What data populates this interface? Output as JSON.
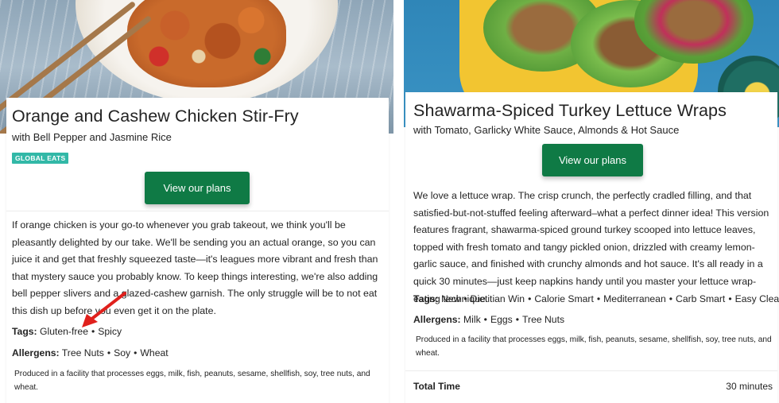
{
  "left_recipe": {
    "title": "Orange and Cashew Chicken Stir-Fry",
    "subtitle": "with Bell Pepper and Jasmine Rice",
    "badge": "GLOBAL EATS",
    "button_label": "View our plans",
    "description": "If orange chicken is your go-to whenever you grab takeout, we think you'll be pleasantly delighted by our take. We'll be sending you an actual orange, so you can juice it and get that freshly squeezed taste—it's leagues more vibrant and fresh than that mystery sauce you probably know. To keep things interesting, we're also adding bell pepper slivers and a glazed-cashew garnish. The only struggle will be to not eat this dish up before you even get it on the plate.",
    "tags_label": "Tags:",
    "tags": [
      "Gluten-free",
      "Spicy"
    ],
    "allergens_label": "Allergens:",
    "allergens": [
      "Tree Nuts",
      "Soy",
      "Wheat"
    ],
    "facility_note": "Produced in a facility that processes eggs, milk, fish, peanuts, sesame, shellfish, soy, tree nuts, and wheat.",
    "annotation_color": "#e0201c"
  },
  "right_recipe": {
    "title": "Shawarma-Spiced Turkey Lettuce Wraps",
    "subtitle": "with Tomato, Garlicky White Sauce, Almonds & Hot Sauce",
    "button_label": "View our plans",
    "description": "We love a lettuce wrap. The crisp crunch, the perfectly cradled filling, and that satisfied-but-not-stuffed feeling afterward–what a perfect dinner idea! This version features fragrant, shawarma-spiced ground turkey scooped into lettuce leaves, topped with fresh tomato and tangy pickled onion, drizzled with creamy lemon-garlic sauce, and finished with crunchy almonds and hot sauce. It's all ready in a quick 30 minutes—just keep napkins handy until you master your lettuce wrap-eating technique.",
    "tags_label": "Tags:",
    "tags": [
      "New",
      "Dietitian Win",
      "Calorie Smart",
      "Mediterranean",
      "Carb Smart",
      "Easy Cleanup"
    ],
    "allergens_label": "Allergens:",
    "allergens": [
      "Milk",
      "Eggs",
      "Tree Nuts"
    ],
    "facility_note": "Produced in a facility that processes eggs, milk, fish, peanuts, sesame, shellfish, soy, tree nuts, and wheat.",
    "total_time_label": "Total Time",
    "total_time_value": "30 minutes"
  },
  "colors": {
    "button": "#0f7a45",
    "badge": "#32b8a7",
    "text": "#242424"
  }
}
